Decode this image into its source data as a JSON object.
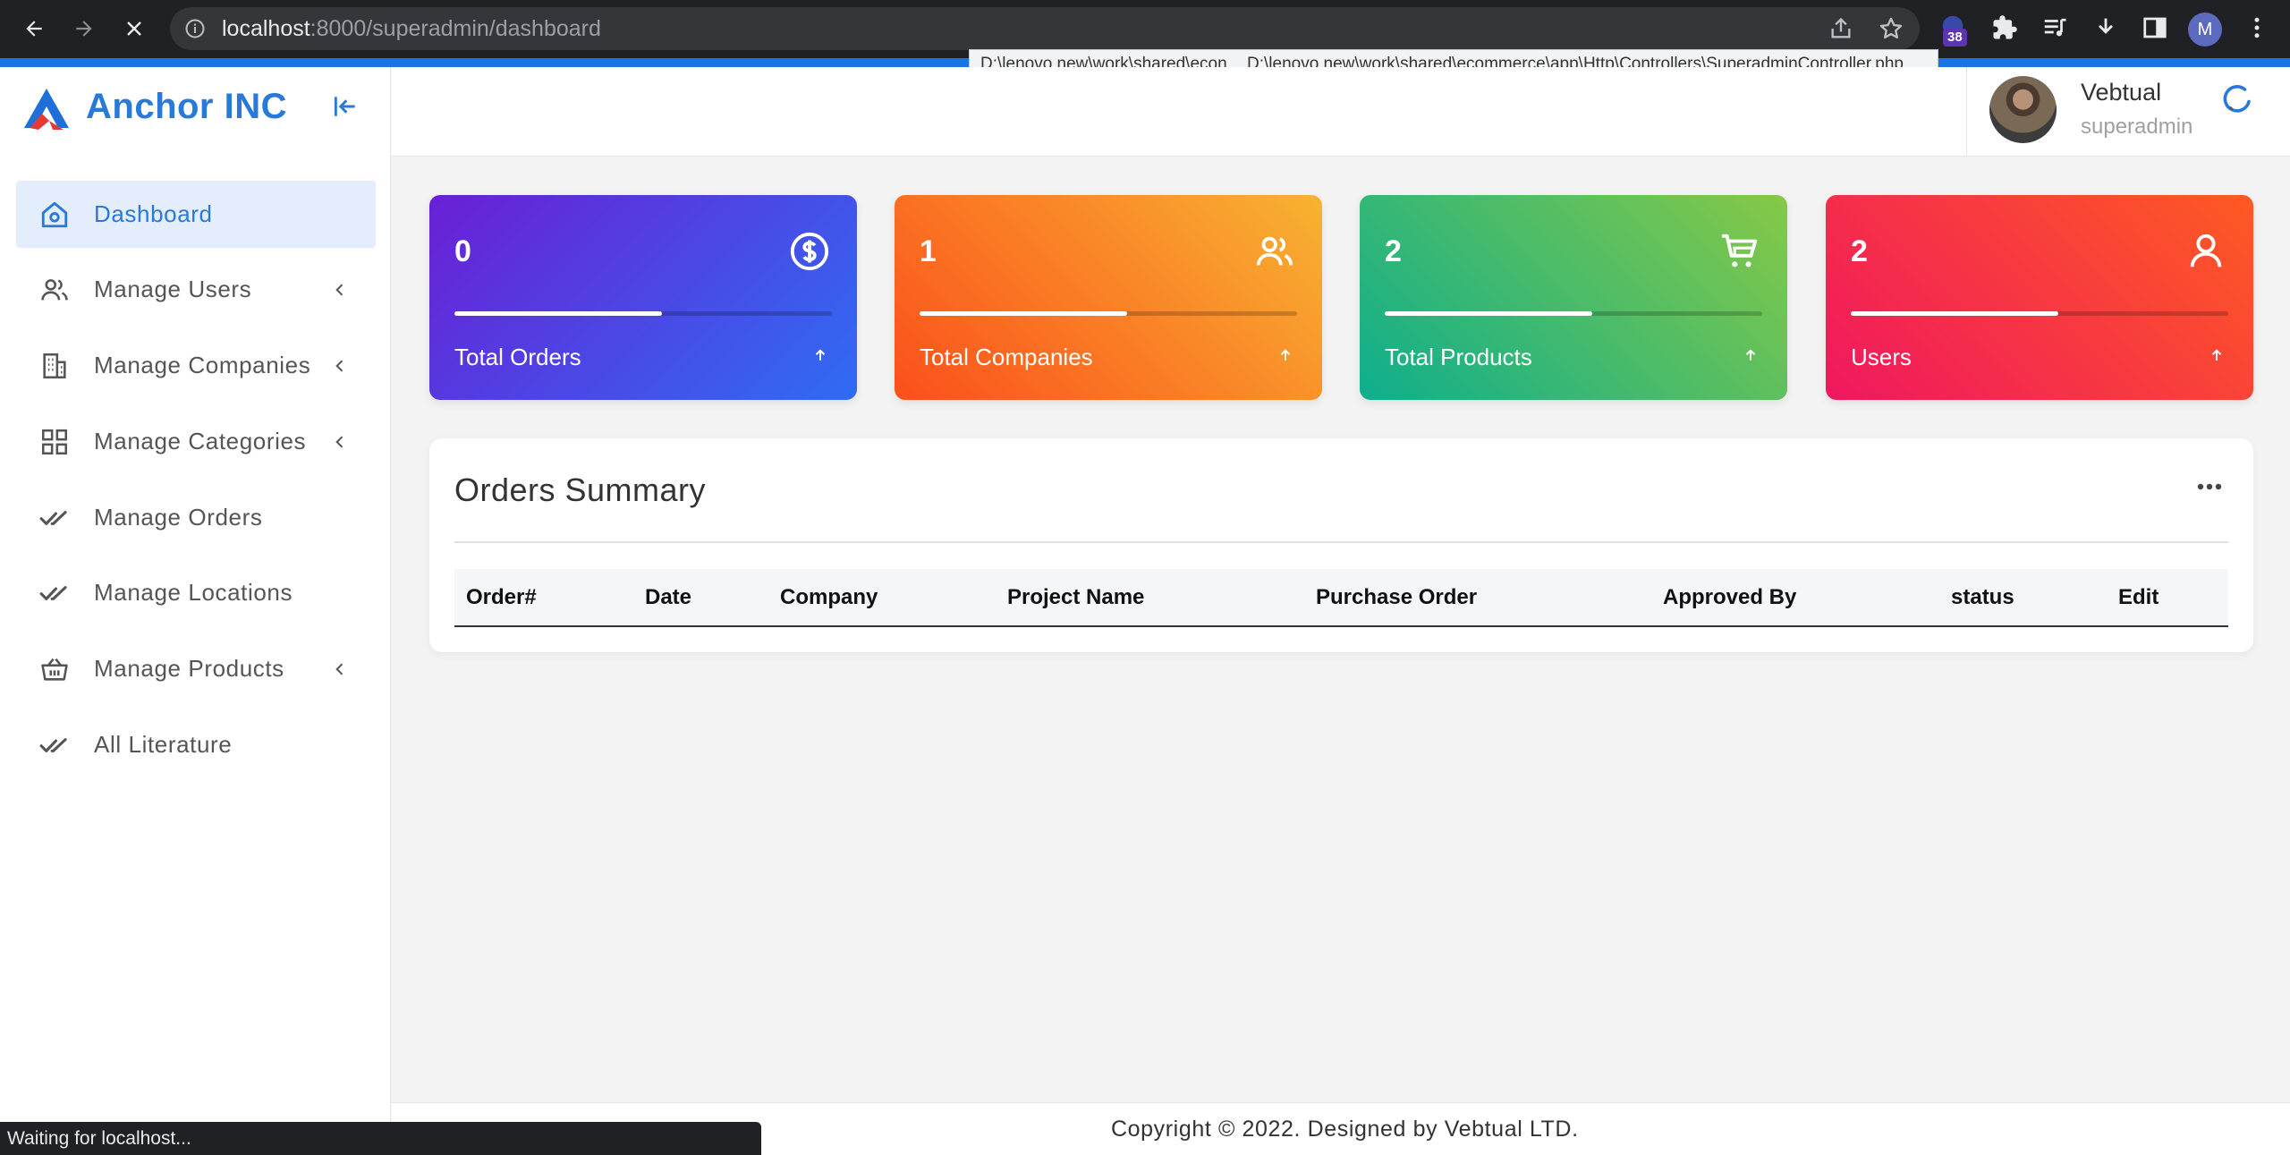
{
  "browser": {
    "url_host": "localhost",
    "url_path": ":8000/superadmin/dashboard",
    "status_tooltip_1": "D:\\lenovo new\\work\\shared\\econ",
    "status_tooltip_2": "D:\\lenovo new\\work\\shared\\ecommerce\\app\\Http\\Controllers\\SuperadminController.php",
    "extension_badge": "38",
    "profile_initial": "M",
    "status_bubble": "Waiting for localhost...",
    "accent": "#1a73e8"
  },
  "sidebar": {
    "brand": "Anchor INC",
    "brand_color": "#2979d9",
    "items": [
      {
        "label": "Dashboard",
        "icon": "home-icon",
        "active": true,
        "chevron": false
      },
      {
        "label": "Manage Users",
        "icon": "users-icon",
        "active": false,
        "chevron": true
      },
      {
        "label": "Manage Companies",
        "icon": "building-icon",
        "active": false,
        "chevron": true
      },
      {
        "label": "Manage Categories",
        "icon": "grid-icon",
        "active": false,
        "chevron": true
      },
      {
        "label": "Manage Orders",
        "icon": "double-check-icon",
        "active": false,
        "chevron": false
      },
      {
        "label": "Manage Locations",
        "icon": "double-check-icon",
        "active": false,
        "chevron": false
      },
      {
        "label": "Manage Products",
        "icon": "basket-icon",
        "active": false,
        "chevron": true
      },
      {
        "label": "All Literature",
        "icon": "double-check-icon",
        "active": false,
        "chevron": false
      }
    ]
  },
  "header": {
    "user_name": "Vebtual",
    "user_role": "superadmin"
  },
  "cards": {
    "orders": {
      "value": "0",
      "label": "Total Orders",
      "icon": "dollar-circle-icon",
      "progress": 0.55
    },
    "companies": {
      "value": "1",
      "label": "Total Companies",
      "icon": "users-icon",
      "progress": 0.55
    },
    "products": {
      "value": "2",
      "label": "Total Products",
      "icon": "cart-icon",
      "progress": 0.55
    },
    "users": {
      "value": "2",
      "label": "Users",
      "icon": "user-icon",
      "progress": 0.55
    }
  },
  "orders_summary": {
    "title": "Orders Summary",
    "columns": [
      "Order#",
      "Date",
      "Company",
      "Project Name",
      "Purchase Order",
      "Approved By",
      "status",
      "Edit"
    ],
    "rows": []
  },
  "footer": {
    "text": "Copyright © 2022. Designed by Vebtual LTD."
  }
}
